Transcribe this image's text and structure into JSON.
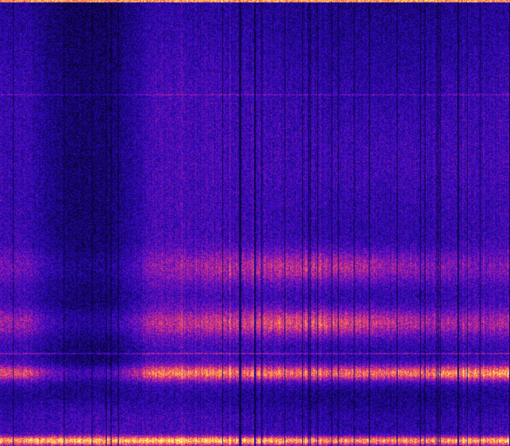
{
  "image": {
    "kind": "spectrogram",
    "colormap": "plasma-like",
    "colors": {
      "background": "#05020f",
      "low": "#1a0a8c",
      "mid": "#b0208c",
      "high": "#ff6a2a",
      "peak": "#fff27a"
    },
    "intensity_bands": [
      {
        "level": "faint",
        "description_key": "upper-band"
      },
      {
        "level": "medium",
        "description_key": "middle-band"
      },
      {
        "level": "strong",
        "description_key": "lower-band"
      },
      {
        "level": "very-strong",
        "description_key": "bottom-band"
      }
    ]
  }
}
